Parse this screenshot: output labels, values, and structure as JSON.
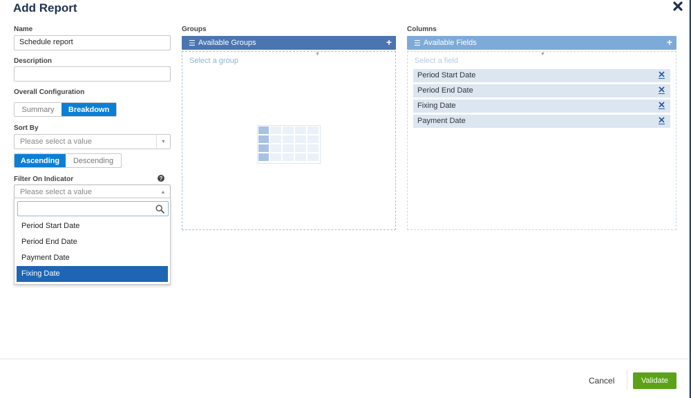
{
  "title": "Add Report",
  "left": {
    "name_label": "Name",
    "name_value": "Schedule report",
    "description_label": "Description",
    "description_value": "",
    "overall_label": "Overall Configuration",
    "overall_options": [
      "Summary",
      "Breakdown"
    ],
    "overall_selected": "Breakdown",
    "sort_label": "Sort By",
    "sort_placeholder": "Please select a value",
    "order_options": [
      "Ascending",
      "Descending"
    ],
    "order_selected": "Ascending",
    "filter_label": "Filter On Indicator",
    "filter_help": "?",
    "filter_placeholder": "Please select a value",
    "filter_options": [
      "Period Start Date",
      "Period End Date",
      "Payment Date",
      "Fixing Date"
    ],
    "filter_highlighted": "Fixing Date"
  },
  "groups": {
    "label": "Groups",
    "header": "Available Groups",
    "placeholder": "Select a group"
  },
  "columns": {
    "label": "Columns",
    "header": "Available Fields",
    "placeholder": "Select a field",
    "fields": [
      "Period Start Date",
      "Period End Date",
      "Fixing Date",
      "Payment Date"
    ]
  },
  "footer": {
    "cancel": "Cancel",
    "validate": "Validate"
  },
  "colors": {
    "primary": "#0b7fd6",
    "groups_header": "#4a75b0",
    "columns_header": "#7eaad8",
    "validate": "#5ba219",
    "title": "#1e3050"
  },
  "icons": {
    "close": "close-icon",
    "list": "list-icon",
    "add": "plus-icon",
    "remove": "remove-x-icon",
    "search": "search-icon",
    "help": "question-circle-icon",
    "placeholder": "table-grid-icon"
  }
}
